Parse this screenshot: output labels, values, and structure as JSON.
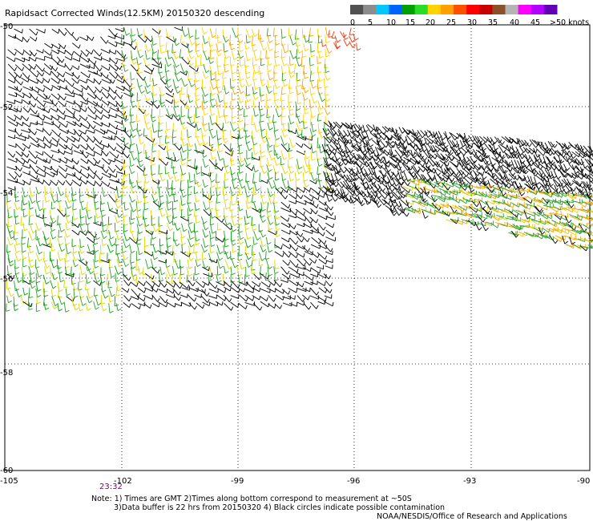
{
  "title": "Rapidsact Corrected Winds(12.5KM) 20150320 descending",
  "legend": {
    "labels": [
      "0",
      "5",
      "10",
      "15",
      "20",
      "25",
      "30",
      "35",
      "40",
      "45",
      ">50 knots"
    ],
    "colors": [
      "#505050",
      "#8c8c8c",
      "#00c8ff",
      "#0064ff",
      "#00a000",
      "#28dc28",
      "#ffd200",
      "#ffa000",
      "#ff5000",
      "#ff0000",
      "#c80000",
      "#8c5028",
      "#b4b4b4",
      "#ff00ff",
      "#b400ff",
      "#6400b4"
    ]
  },
  "axes": {
    "lat_labels": [
      "-50",
      "-52",
      "-54",
      "-56",
      "-58",
      "-60"
    ],
    "lon_labels": [
      "-105",
      "-102",
      "-99",
      "-96",
      "-93",
      "-90"
    ]
  },
  "time_label": "23:32",
  "notes": [
    "Note: 1) Times are GMT 2)Times along bottom correspond to measurement at ~50S",
    "3)Data buffer is 22 hrs from 20150320 4) Black circles indicate possible contamination"
  ],
  "credit": "NOAA/NESDIS/Office of Research and Applications",
  "swaths": [
    {
      "name": "left-swath",
      "color_note": "black/yellow/green mixed"
    },
    {
      "name": "right-swath",
      "color_note": "black/green/orange mixed"
    }
  ]
}
